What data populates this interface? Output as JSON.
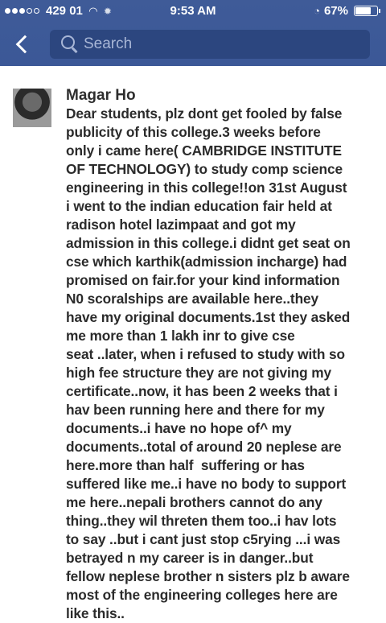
{
  "status_bar": {
    "carrier": "429 01",
    "time": "9:53 AM",
    "battery": "67%",
    "battery_level": 0.67
  },
  "nav": {
    "search_placeholder": "Search"
  },
  "post": {
    "author": "Magar Ho",
    "lines": [
      "Dear students, plz dont get fooled by false",
      "publicity of this college.3 weeks before",
      "only i came here( CAMBRIDGE INSTITUTE",
      "OF TECHNOLOGY) to study comp science",
      "engineering in this college!!on 31st August",
      "i went to the indian education fair held at",
      "radison hotel lazimpaat and got my",
      "admission in this college.i didnt get seat on",
      "cse which karthik(admission incharge) had",
      "promised on fair.for your kind information",
      "N0 scoralships are available here..they",
      "have my original documents.1st they asked",
      "me more than 1 lakh inr to give cse",
      "seat ..later, when i refused to study with so",
      "high fee structure they are not giving my",
      "certificate..now, it has been 2 weeks that i",
      "hav been running here and there for my",
      "documents..i have no hope of^ my",
      "documents..total of around 20 neplese are",
      "here.more than half  suffering or has",
      "suffered like me..i have no body to support",
      "me here..nepali brothers cannot do any",
      "thing..they wil threten them too..i hav lots",
      "to say ..but i cant just stop c5rying ...i was",
      "betrayed n my career is in danger..but",
      "fellow neplese brother n sisters plz b aware",
      "most of the engineering colleges here are",
      "like this.."
    ]
  }
}
